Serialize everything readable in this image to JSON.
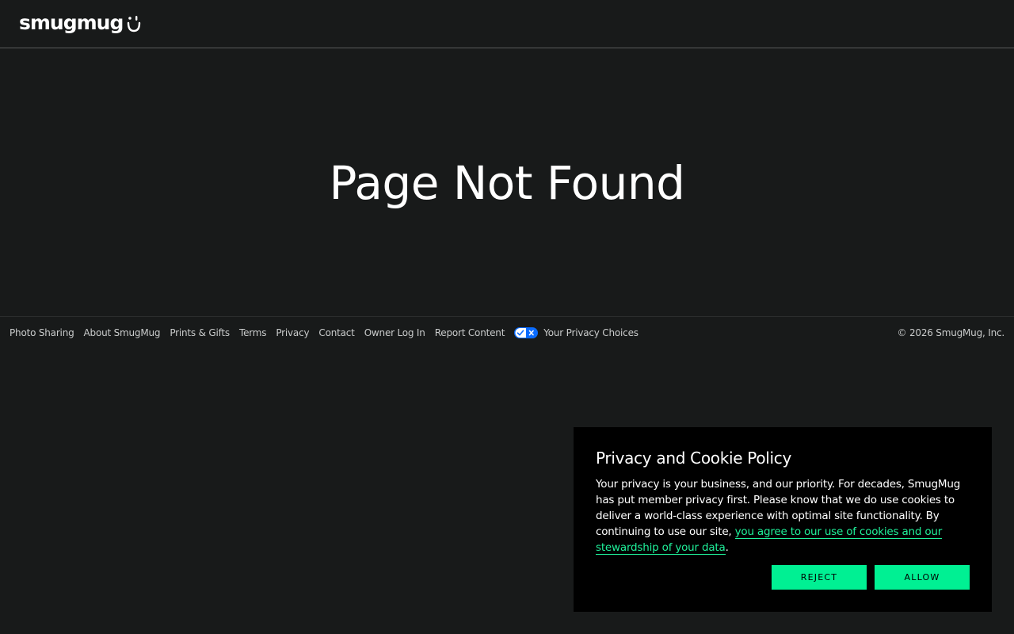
{
  "header": {
    "logo_text": "smugmug",
    "logo_icon": "smile-icon"
  },
  "main": {
    "title": "Page Not Found"
  },
  "footer": {
    "links": [
      "Photo Sharing",
      "About SmugMug",
      "Prints & Gifts",
      "Terms",
      "Privacy",
      "Contact",
      "Owner Log In",
      "Report Content"
    ],
    "privacy_choices": "Your Privacy Choices",
    "privacy_icon": "privacy-toggle-icon",
    "copyright": "© 2026 SmugMug, Inc."
  },
  "cookie_banner": {
    "title": "Privacy and Cookie Policy",
    "text": "Your privacy is your business, and our priority. For decades, SmugMug has put member privacy first. Please know that we do use cookies to deliver a world-class experience with optimal site functionality. By continuing to use our site, ",
    "link_text": "you agree to our use of cookies and our stewardship of your data",
    "text_end": ".",
    "reject_label": "Reject",
    "allow_label": "Allow"
  },
  "colors": {
    "background": "#181a1a",
    "banner_background": "#000000",
    "accent": "#00f093",
    "link": "#1ff09a",
    "footer_text": "#c9cbcb",
    "privacy_toggle": "#0a6cff"
  }
}
